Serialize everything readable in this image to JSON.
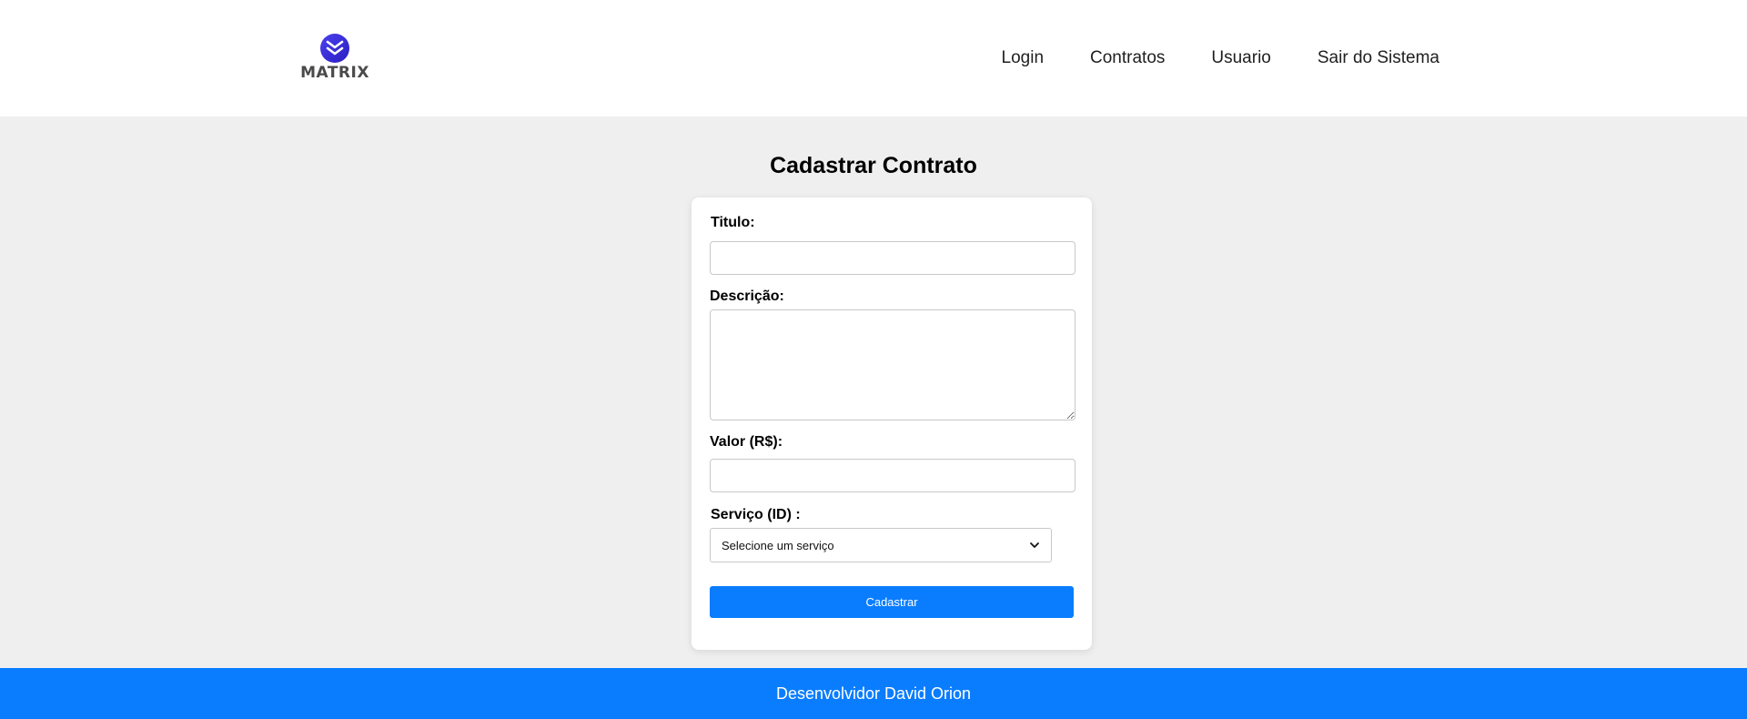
{
  "brand": {
    "name": "MATRIX",
    "logo_icon": "chevrons-down-logo-icon",
    "logo_color": "#3a2fd8"
  },
  "nav": {
    "items": [
      {
        "label": "Login"
      },
      {
        "label": "Contratos"
      },
      {
        "label": "Usuario"
      },
      {
        "label": "Sair do Sistema"
      }
    ]
  },
  "page": {
    "title": "Cadastrar Contrato"
  },
  "form": {
    "titulo_label": "Titulo:",
    "titulo_value": "",
    "descricao_label": "Descrição:",
    "descricao_value": "",
    "valor_label": "Valor (R$):",
    "valor_value": "",
    "servico_label": "Serviço (ID) :",
    "servico_selected": "Selecione um serviço",
    "submit_label": "Cadastrar"
  },
  "footer": {
    "text": "Desenvolvidor David Orion"
  },
  "colors": {
    "accent": "#0a7dff",
    "background": "#efefef",
    "header": "#ffffff"
  }
}
